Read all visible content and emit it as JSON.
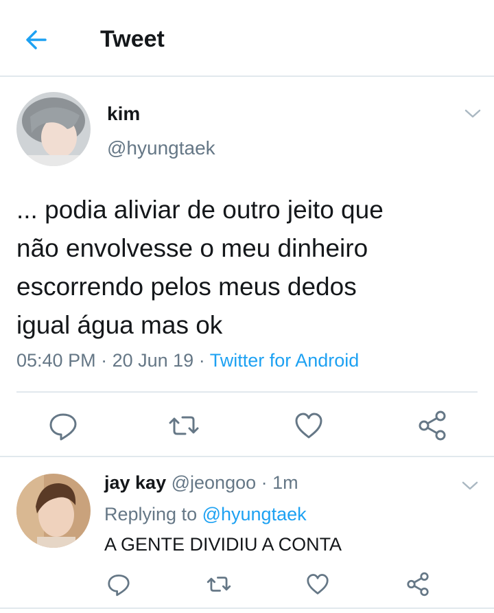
{
  "header": {
    "title": "Tweet",
    "back_icon": "arrow-left-icon",
    "accent": "#1da1f2"
  },
  "tweet": {
    "author_name": "kim",
    "author_handle": "@hyungtaek",
    "text": "... podia aliviar de outro jeito que\nnão envolvesse o meu dinheiro\nescorrendo pelos meus dedos\nigual água mas ok",
    "time": "05:40 PM",
    "date": "20 Jun 19",
    "separator": " · ",
    "source": "Twitter for Android",
    "actions": [
      "reply-icon",
      "retweet-icon",
      "like-icon",
      "share-icon"
    ]
  },
  "reply": {
    "author_name": "jay kay",
    "author_handle": "@jeongoo",
    "separator": " · ",
    "time_ago": "1m",
    "replying_prefix": "Replying to ",
    "replying_to": "@hyungtaek",
    "text": "A GENTE DIVIDIU A CONTA",
    "actions": [
      "reply-icon",
      "retweet-icon",
      "like-icon",
      "share-icon"
    ]
  },
  "colors": {
    "text_primary": "#14171a",
    "text_secondary": "#657786",
    "link": "#1da1f2",
    "divider": "#e1e8ed"
  }
}
